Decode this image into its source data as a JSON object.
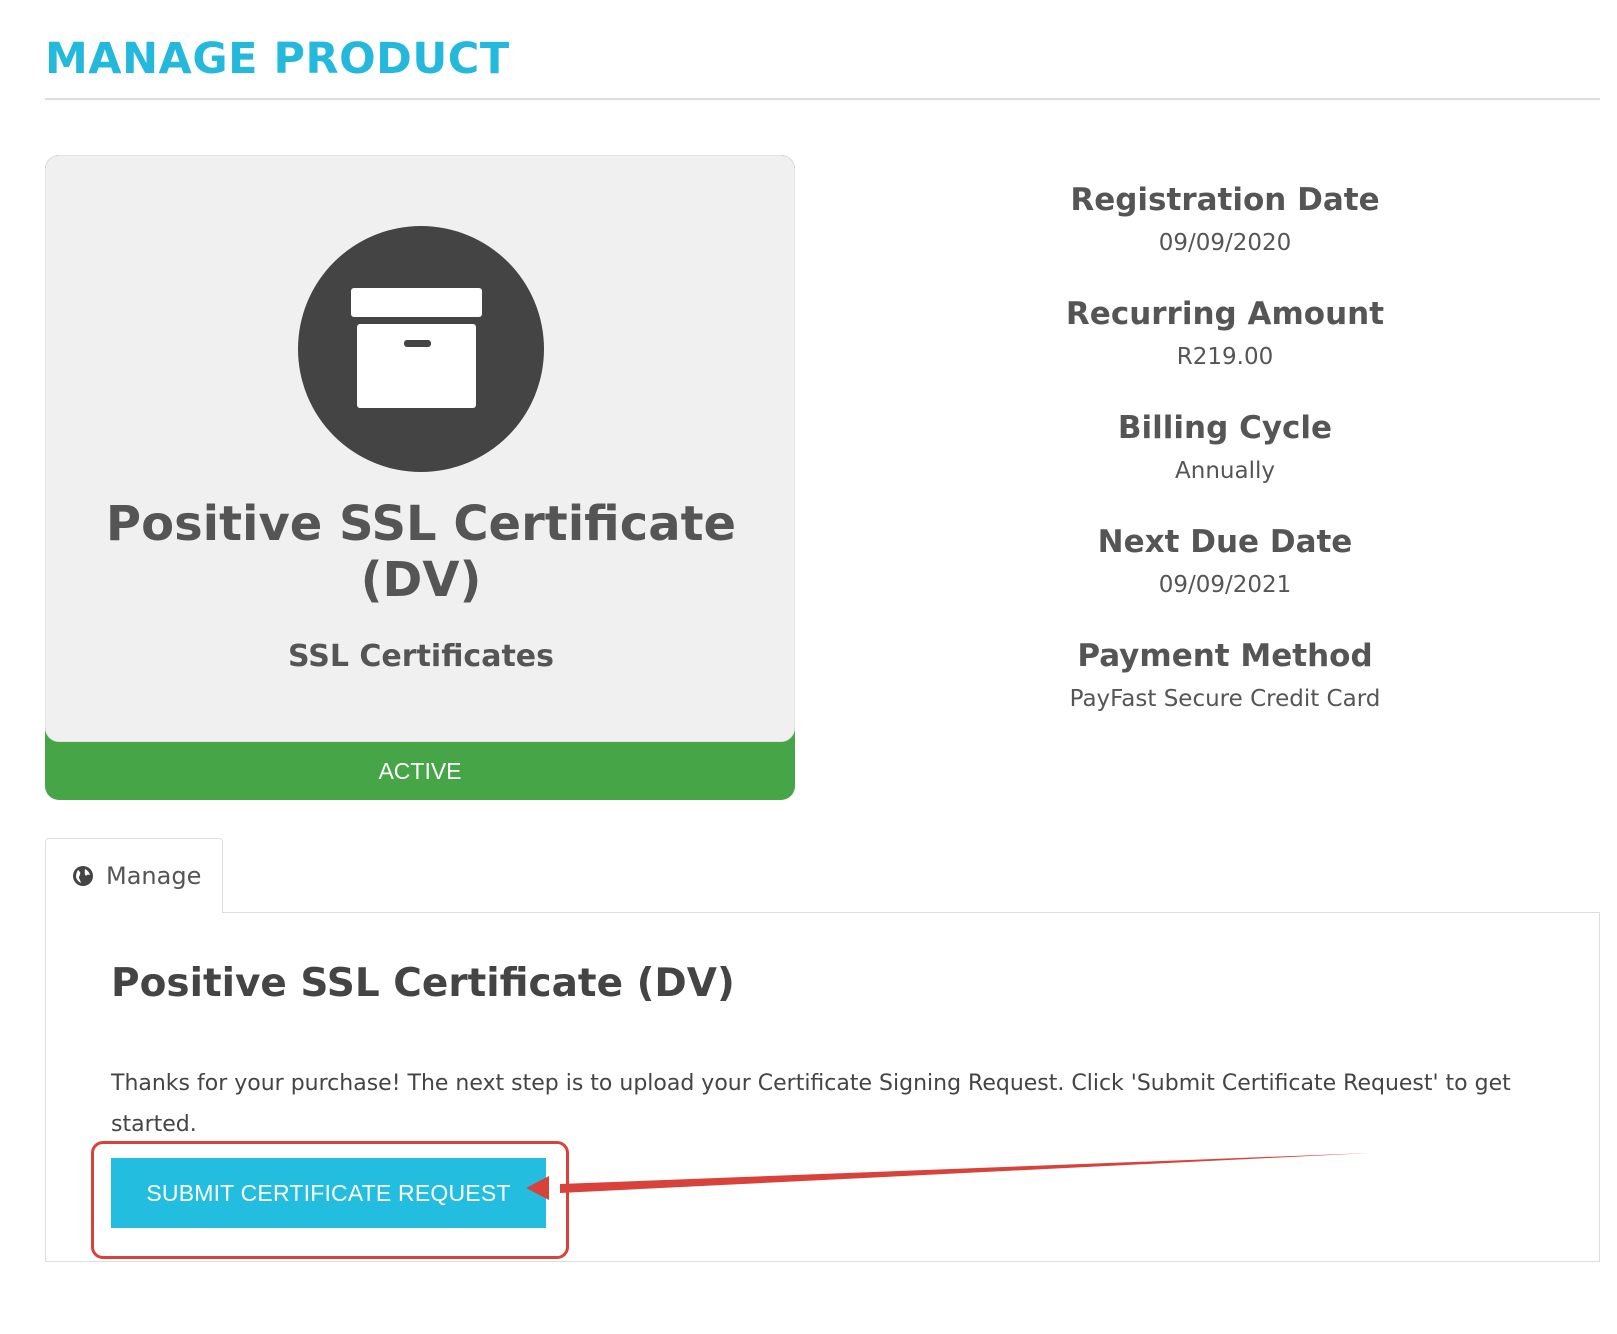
{
  "page": {
    "title": "MANAGE PRODUCT"
  },
  "product": {
    "name": "Positive SSL Certificate (DV)",
    "group": "SSL Certificates",
    "status": "ACTIVE",
    "icon": "archive-box-icon"
  },
  "details": [
    {
      "label": "Registration Date",
      "value": "09/09/2020"
    },
    {
      "label": "Recurring Amount",
      "value": "R219.00"
    },
    {
      "label": "Billing Cycle",
      "value": "Annually"
    },
    {
      "label": "Next Due Date",
      "value": "09/09/2021"
    },
    {
      "label": "Payment Method",
      "value": "PayFast Secure Credit Card"
    }
  ],
  "tabs": [
    {
      "label": "Manage",
      "icon": "globe-icon"
    }
  ],
  "panel": {
    "heading": "Positive SSL Certificate (DV)",
    "text": "Thanks for your purchase! The next step is to upload your Certificate Signing Request. Click 'Submit Certificate Request' to get started.",
    "button_label": "SUBMIT CERTIFICATE REQUEST"
  },
  "colors": {
    "accent": "#23b8dc",
    "button": "#23bedf",
    "status_active": "#46a546",
    "annotation": "#d9423a"
  }
}
